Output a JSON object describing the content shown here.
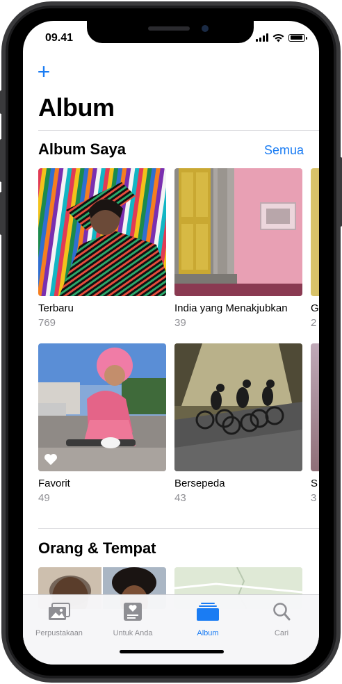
{
  "status_bar": {
    "time": "09.41"
  },
  "nav": {
    "add_label": "+"
  },
  "page": {
    "title": "Album"
  },
  "my_albums": {
    "title": "Album Saya",
    "see_all": "Semua",
    "items": [
      {
        "name": "Terbaru",
        "count": "769"
      },
      {
        "name": "India yang Menakjubkan",
        "count": "39"
      },
      {
        "name": "G",
        "count": "2"
      },
      {
        "name": "Favorit",
        "count": "49"
      },
      {
        "name": "Bersepeda",
        "count": "43"
      },
      {
        "name": "S",
        "count": "3"
      }
    ]
  },
  "people_places": {
    "title": "Orang & Tempat"
  },
  "tab_bar": {
    "tabs": [
      {
        "label": "Perpustakaan",
        "icon": "photo-library-icon",
        "active": false
      },
      {
        "label": "Untuk Anda",
        "icon": "for-you-icon",
        "active": false
      },
      {
        "label": "Album",
        "icon": "album-stack-icon",
        "active": true
      },
      {
        "label": "Cari",
        "icon": "search-icon",
        "active": false
      }
    ]
  },
  "colors": {
    "accent": "#1a7cf3",
    "secondary_text": "#8e8e93"
  }
}
